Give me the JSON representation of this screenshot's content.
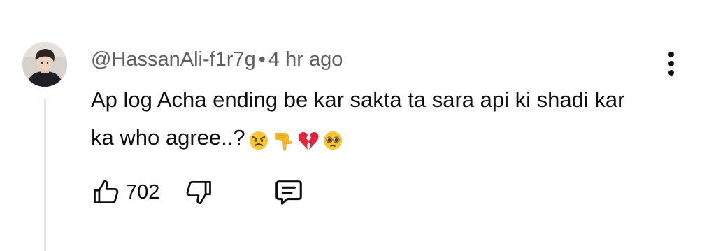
{
  "comment": {
    "author": "@HassanAli-f1r7g",
    "separator": "•",
    "time": "4 hr ago",
    "text": "Ap log Acha ending be kar sakta ta sara api ki shadi kar ka who agree..?",
    "emojis": [
      "angry-face",
      "backhand-index-pointing-down",
      "broken-heart",
      "pleading-face"
    ]
  },
  "actions": {
    "like_count": "702"
  },
  "icons": {
    "like": "thumbs-up-icon",
    "dislike": "thumbs-down-icon",
    "reply": "reply-comment-icon",
    "menu": "more-vertical-icon"
  },
  "colors": {
    "meta_text": "#606060",
    "body_text": "#0f0f0f",
    "thread_line": "#e6e6e6"
  }
}
